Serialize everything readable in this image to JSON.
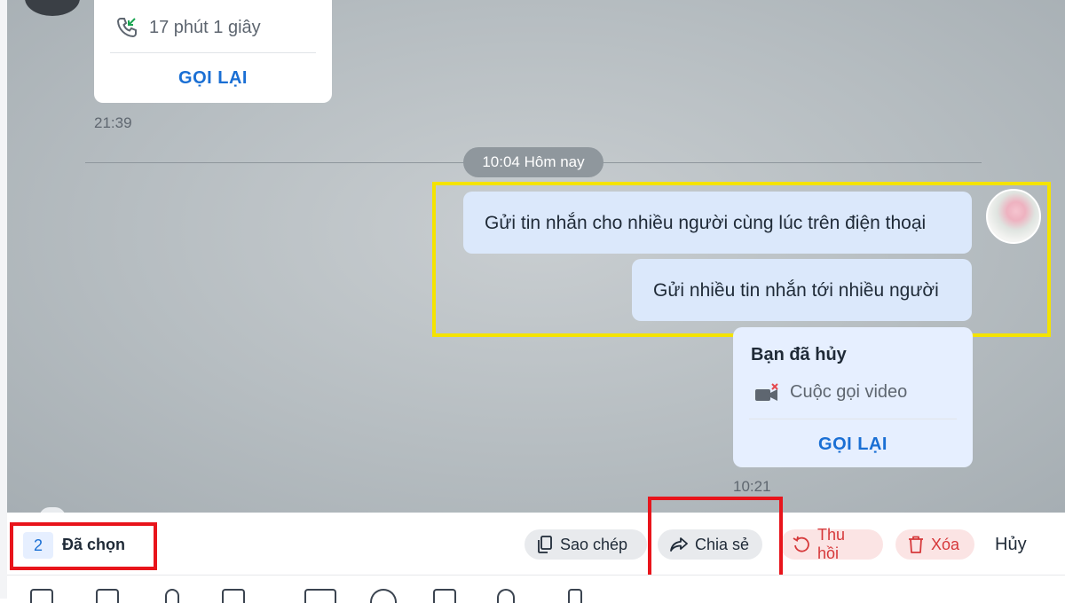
{
  "chat": {
    "call_card_1": {
      "duration": "17 phút 1 giây",
      "recall_label": "GỌI LẠI",
      "time": "21:39"
    },
    "date_divider": "10:04 Hôm nay",
    "messages": [
      "Gửi tin nhắn cho nhiều người cùng lúc trên điện thoại",
      "Gửi nhiều tin nhắn tới nhiều người"
    ],
    "call_card_2": {
      "title": "Bạn đã hủy",
      "type": "Cuộc gọi video",
      "recall_label": "GỌI LẠI",
      "time": "10:21"
    }
  },
  "selection_bar": {
    "count": "2",
    "selected_label": "Đã chọn",
    "copy_label": "Sao chép",
    "share_label": "Chia sẻ",
    "recall_label": "Thu hồi",
    "delete_label": "Xóa",
    "cancel_label": "Hủy"
  },
  "icons": {
    "incoming_call": "phone-incoming-icon",
    "video_call": "video-camera-icon",
    "copy": "copy-icon",
    "share": "share-arrow-icon",
    "recall": "undo-icon",
    "delete": "trash-icon"
  },
  "colors": {
    "accent_blue": "#1a6fd4",
    "bubble_blue": "#dbe8fb",
    "danger_red": "#d6383a",
    "highlight_yellow": "#f4e300",
    "highlight_red": "#e8141b"
  }
}
